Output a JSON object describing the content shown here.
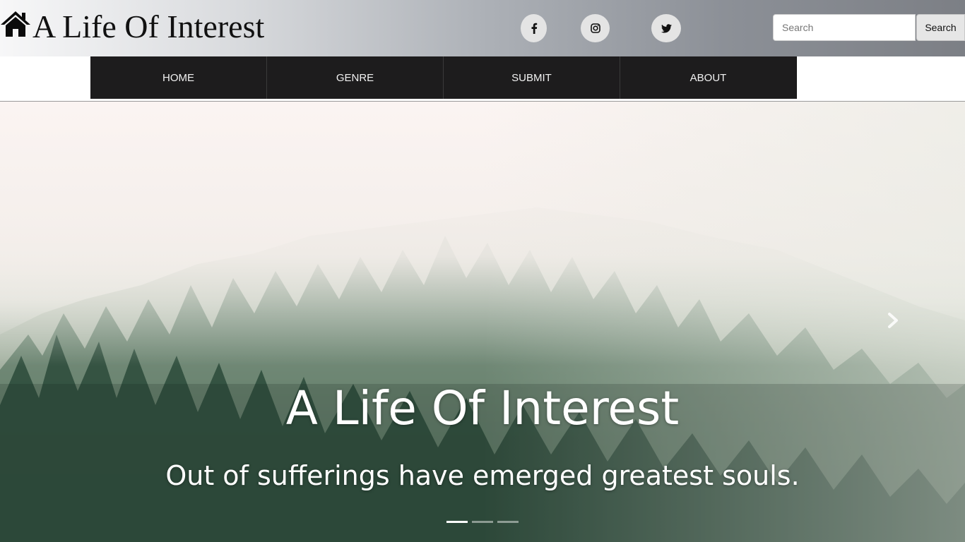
{
  "brand": {
    "title": "A Life Of Interest",
    "icon": "home-icon"
  },
  "social": [
    {
      "name": "facebook",
      "icon": "facebook-icon"
    },
    {
      "name": "instagram",
      "icon": "instagram-icon"
    },
    {
      "name": "twitter",
      "icon": "twitter-icon"
    }
  ],
  "search": {
    "placeholder": "Search",
    "value": "",
    "button_label": "Search"
  },
  "nav": {
    "items": [
      {
        "label": "HOME"
      },
      {
        "label": "GENRE"
      },
      {
        "label": "SUBMIT"
      },
      {
        "label": "ABOUT"
      }
    ]
  },
  "hero": {
    "title": "A Life Of Interest",
    "subtitle": "Out of sufferings have emerged greatest souls.",
    "next_icon": "chevron-right-icon",
    "slides_total": 3,
    "active_slide": 1
  },
  "colors": {
    "nav_background": "#1d1c1d",
    "nav_text": "#f2f2f2",
    "hero_text": "#ffffff"
  }
}
